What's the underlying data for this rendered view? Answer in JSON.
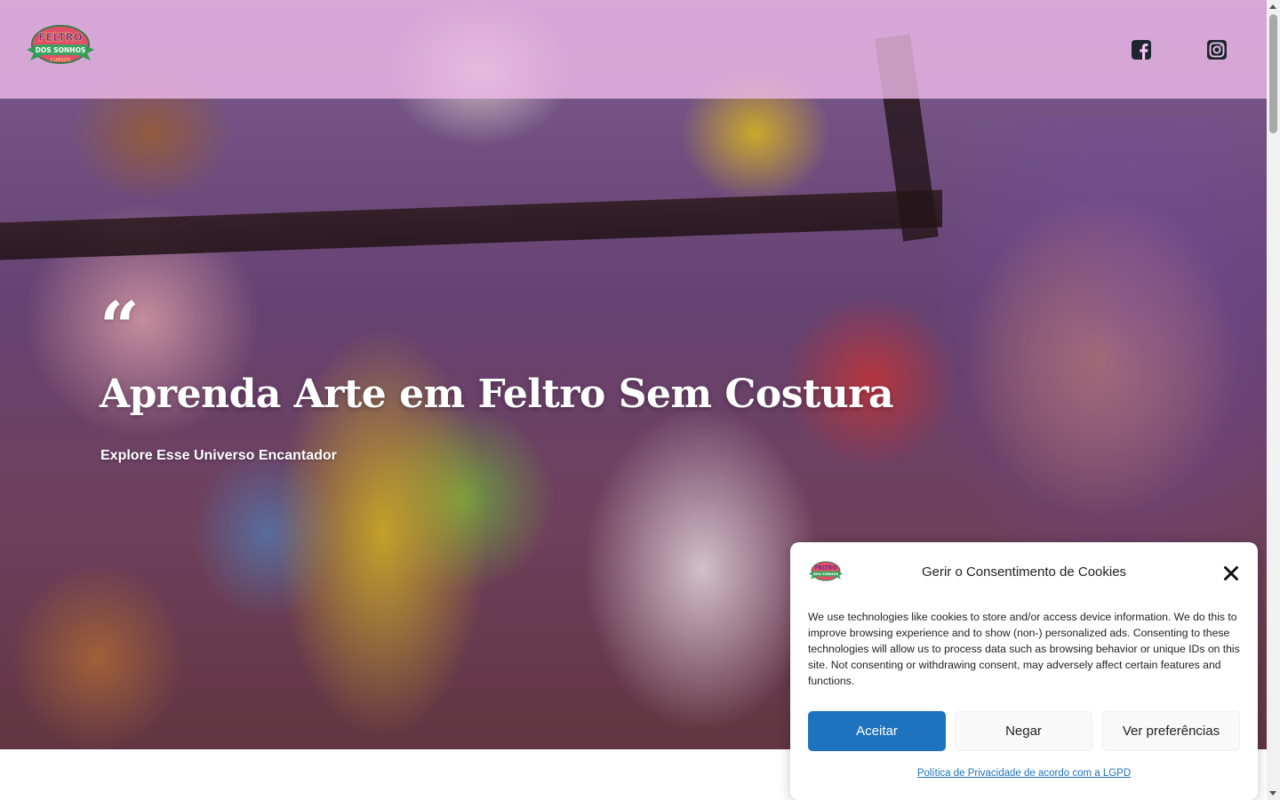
{
  "header": {
    "logo": {
      "icon": "feltro-dos-sonhos-logo",
      "lettering": [
        "Feltro",
        "Dos Sonhos",
        "Cursos"
      ],
      "colors": {
        "badge": "#e34f6a",
        "ribbon": "#2f9a52",
        "text": "#ffe36b"
      }
    },
    "social": [
      {
        "icon": "facebook-icon",
        "color": "#1f2530"
      },
      {
        "icon": "instagram-icon",
        "color": "#1f2530"
      }
    ],
    "background_color": "#eebae8"
  },
  "hero": {
    "quote_icon": "quote-icon",
    "quote_glyph": "“",
    "title": "Aprenda Arte em Feltro Sem Costura",
    "subtitle": "Explore Esse Universo Encantador",
    "background_image": "felt-toys-photo"
  },
  "cookie_banner": {
    "logo_icon": "feltro-dos-sonhos-logo",
    "title": "Gerir o Consentimento de Cookies",
    "close_icon": "close-icon",
    "body": "We use technologies like cookies to store and/or access device information. We do this to improve browsing experience and to show (non-) personalized ads. Consenting to these technologies will allow us to process data such as browsing behavior or unique IDs on this site. Not consenting or withdrawing consent, may adversely affect certain features and functions.",
    "buttons": {
      "accept": "Aceitar",
      "deny": "Negar",
      "preferences": "Ver preferências"
    },
    "policy_link": "Política de Privacidade de acordo com a LGPD",
    "accent_color": "#1e73be"
  }
}
